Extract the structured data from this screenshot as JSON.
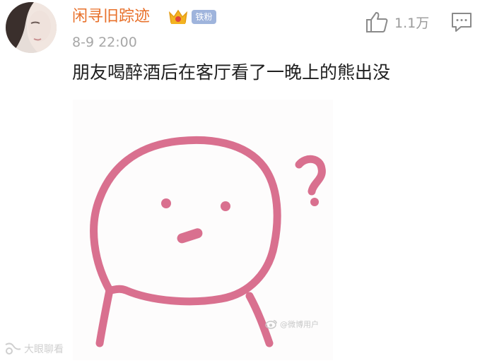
{
  "post": {
    "author": {
      "name": "闲寻旧踪迹",
      "badge": "铁粉"
    },
    "timestamp": "8-9 22:00",
    "like_count": "1.1万",
    "text": "朋友喝醉酒后在客厅看了一晚上的熊出没"
  },
  "icons": {
    "crown": "crown-icon",
    "like": "thumbs-up-icon",
    "comment": "comment-icon"
  },
  "colors": {
    "username": "#e8702a",
    "badge": "#9fb4dc",
    "drawing": "#d9708f"
  }
}
